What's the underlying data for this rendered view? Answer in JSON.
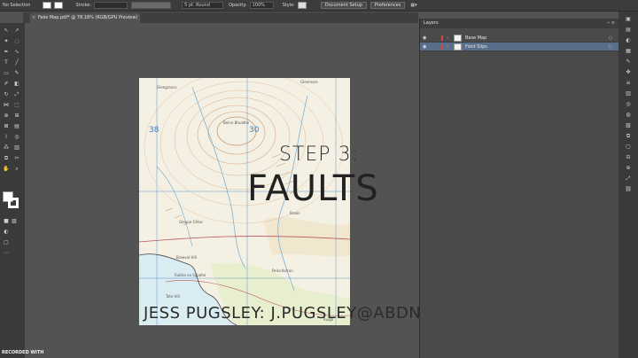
{
  "control_bar": {
    "selection": "No Selection",
    "stroke_label": "Stroke:",
    "stroke_profile": "5 pt. Round",
    "opacity_label": "Opacity:",
    "opacity_value": "100%",
    "style_label": "Style:",
    "document_setup_label": "Document Setup",
    "preferences_label": "Preferences"
  },
  "document_tab": {
    "title": "Fake Map.pdf* @ 78.18% (RGB/GPU Preview)"
  },
  "map": {
    "labels": [
      "Glengrasco",
      "Beinn Bhuidhe",
      "Glenmore",
      "Braes",
      "Gleann Ghlas",
      "Braeval Hill",
      "Rubha na Sgiathe",
      "Tote Hill",
      "Peinchorran",
      "Ruigh"
    ],
    "grid_numbers": [
      "38",
      "30"
    ]
  },
  "overlay": {
    "step": "STEP 3:",
    "title": "FAULTS",
    "credit": "JESS PUGSLEY: J.PUGSLEY@ABDN.AC.UK"
  },
  "layers_panel": {
    "title": "Layers",
    "layers": [
      {
        "name": "Base Map",
        "selected": false
      },
      {
        "name": "Field Slips",
        "selected": true
      }
    ]
  },
  "watermark": "RECORDED WITH",
  "colors": {
    "accent": "#596e8a",
    "layer_color": "#d8453b",
    "map_grid": "#3b7fc3"
  }
}
